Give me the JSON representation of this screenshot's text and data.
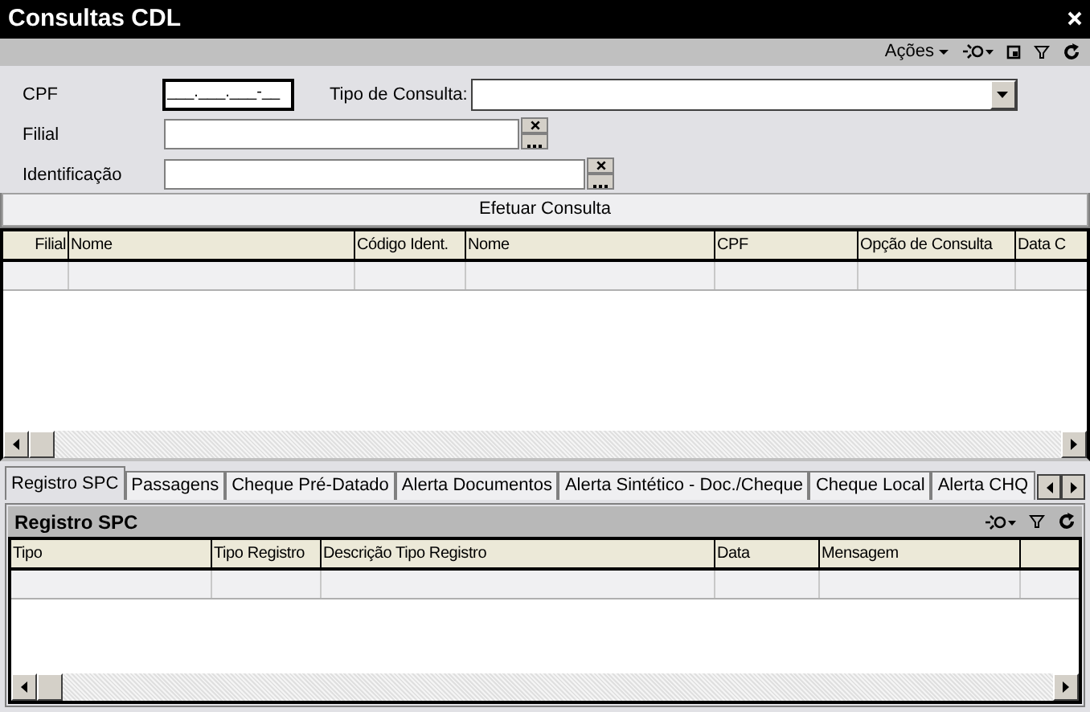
{
  "window": {
    "title": "Consultas CDL"
  },
  "toolbar": {
    "actions_label": "Ações"
  },
  "form": {
    "cpf": {
      "label": "CPF",
      "value": "___.___.___-__"
    },
    "tipo_consulta": {
      "label": "Tipo de Consulta:"
    },
    "filial": {
      "label": "Filial"
    },
    "identificacao": {
      "label": "Identificação"
    }
  },
  "submit_button": "Efetuar Consulta",
  "table": {
    "columns": [
      "Filial",
      "Nome",
      "Código Ident.",
      "Nome",
      "CPF",
      "Opção de Consulta",
      "Data C"
    ]
  },
  "tabs": [
    {
      "label": "Registro SPC",
      "selected": true
    },
    {
      "label": "Passagens",
      "selected": false
    },
    {
      "label": "Cheque Pré-Datado",
      "selected": false
    },
    {
      "label": "Alerta Documentos",
      "selected": false
    },
    {
      "label": "Alerta Sintético - Doc./Cheque",
      "selected": false
    },
    {
      "label": "Cheque Local",
      "selected": false
    },
    {
      "label": "Alerta CHQ",
      "selected": false
    }
  ],
  "panel": {
    "title": "Registro SPC",
    "table": {
      "columns": [
        "Tipo",
        "Tipo Registro",
        "Descrição Tipo Registro",
        "Data",
        "Mensagem",
        ""
      ]
    }
  }
}
